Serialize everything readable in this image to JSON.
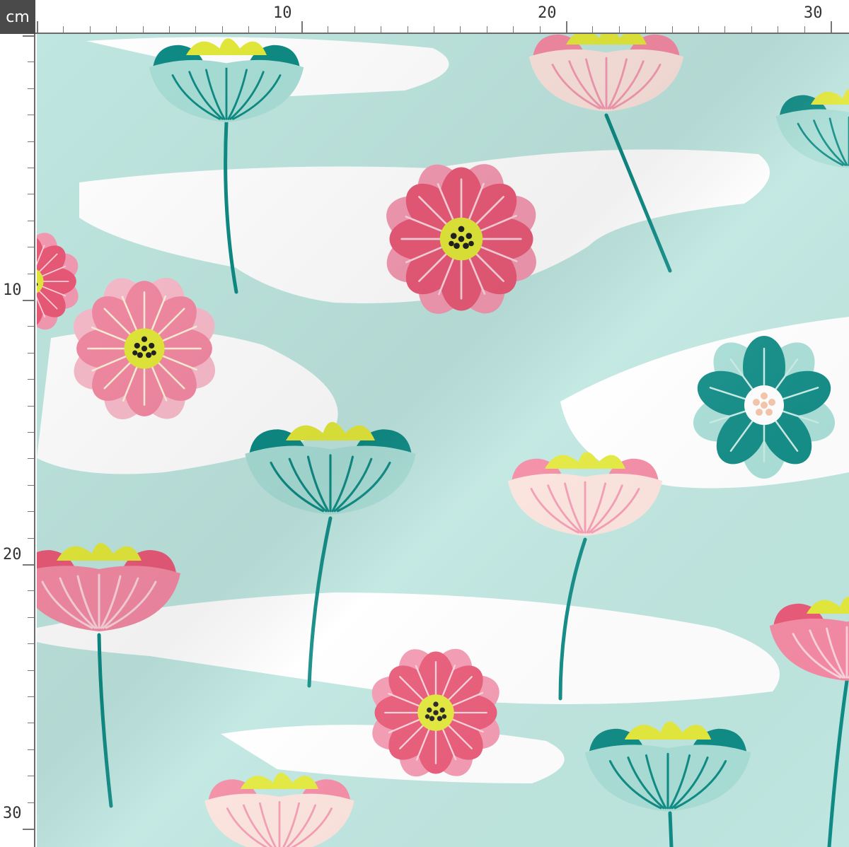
{
  "ruler": {
    "unit": "cm",
    "top_labels": [
      "10",
      "20",
      "30"
    ],
    "left_labels": [
      "10",
      "20",
      "30"
    ],
    "color": "#6b6b6b"
  },
  "fabric": {
    "background": "#bfe6e0",
    "brush_color": "#ffffff",
    "motif": [
      {
        "kind": "cosmos-flower",
        "palette": "coral-pink"
      },
      {
        "kind": "cosmos-flower",
        "palette": "light-pink"
      },
      {
        "kind": "cosmos-flower",
        "palette": "teal"
      },
      {
        "kind": "tulip-flower",
        "palette": "teal"
      },
      {
        "kind": "tulip-flower",
        "palette": "cream-pink"
      },
      {
        "kind": "tulip-flower",
        "palette": "coral-pink"
      }
    ],
    "colors": {
      "teal_dark": "#0f8b85",
      "teal_light": "#9ed9d2",
      "coral": "#e95a78",
      "pink": "#f49ab2",
      "cream": "#fbe3dc",
      "center_yellow": "#e3e93a",
      "seed_dark": "#222222"
    }
  }
}
